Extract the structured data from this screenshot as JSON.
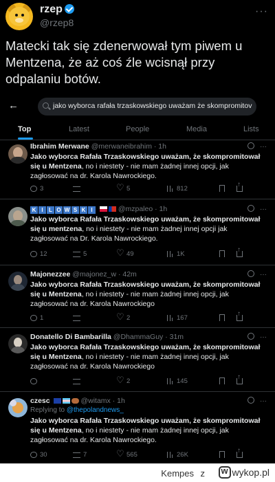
{
  "outer": {
    "name": "rzep",
    "handle": "@rzep8",
    "more": "···",
    "text": "Matecki tak się zdenerwował tym piwem u Mentzena, że aż coś źle wcisnął przy odpalaniu botów."
  },
  "search": {
    "query": "jako wyborca rafała trzaskowskiego uważam że skompromitov"
  },
  "tabs": [
    "Top",
    "Latest",
    "People",
    "Media",
    "Lists"
  ],
  "tweets": [
    {
      "name": "Ibrahim Merwane",
      "meta": "@merwaneibrahim · 1h",
      "body_bold": "Jako wyborca Rafała Trzaskowskiego uważam, że skompromitował się u Mentzena",
      "body_rest": ", no i niestety - nie mam żadnej innej opcji, jak zagłosować na dr. Karola Nawrockiego.",
      "replies": "3",
      "reposts": "",
      "likes": "5",
      "views": "812"
    },
    {
      "name_letters": [
        "K",
        "I",
        "L",
        "O",
        "W",
        "S",
        "K",
        "I"
      ],
      "meta": "@mzpaleo · 1h",
      "body_bold": "Jako wyborca Rafała Trzaskowskiego uważam, że skompromitował się u mentzena",
      "body_rest": ", no i niestety - nie mam żadnej innej opcji jak zagłosować na Dr. Karola Nawrockiego.",
      "replies": "12",
      "reposts": "5",
      "likes": "49",
      "views": "1K"
    },
    {
      "name": "Majonezzee",
      "meta": "@majonez_w · 42m",
      "body_bold": "Jako wyborca Rafała Trzaskowskiego uważam, że skompromitował się u Mentzena",
      "body_rest": ", no i niestety - nie mam żadnej innej opcji, jak zagłosować na dr. Karola Nawrockiego",
      "replies": "1",
      "reposts": "",
      "likes": "2",
      "views": "167"
    },
    {
      "name": "Donatello Di Bambarilla",
      "meta": "@DhammaGuy · 31m",
      "body_bold": "Jako wyborca Rafała Trzaskowskiego uważam, że skompromitował się u Mentzena",
      "body_rest": ", no i niestety - nie mam żadnej innej opcji, jak zagłosować na dr. Karola Nawrockiego",
      "replies": "",
      "reposts": "",
      "likes": "2",
      "views": "145"
    },
    {
      "name": "czesc",
      "meta": "@witamx · 1h",
      "reply_prefix": "Replying to ",
      "reply_handle": "@thepolandnews_",
      "body_bold": "Jako wyborca Rafała Trzaskowskiego uważam, że skompromitował się u Mentzena",
      "body_rest": ", no i niestety - nie mam żadnej innej opcji, jak zagłosować na dr. Karola Nawrockiego.",
      "replies": "30",
      "reposts": "7",
      "likes": "565",
      "views": "26K"
    }
  ],
  "footer": {
    "user": "Kempes",
    "z": "z",
    "site": "wykop.pl"
  },
  "colors": {
    "accent": "#1d9bf0",
    "muted": "#71767b",
    "text": "#e7e9ea",
    "divider": "#2f3336"
  }
}
